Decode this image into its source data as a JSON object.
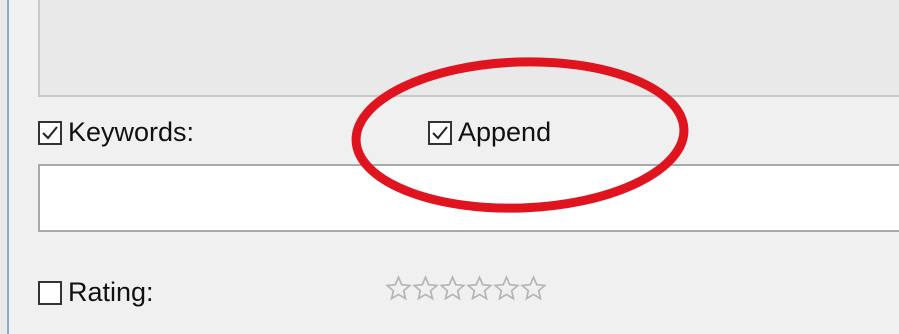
{
  "keywords": {
    "label": "Keywords:",
    "checked": true,
    "input_value": ""
  },
  "append": {
    "label": "Append",
    "checked": true
  },
  "rating": {
    "label": "Rating:",
    "checked": false,
    "value": 0,
    "max": 5
  },
  "colors": {
    "annotation": "#e0141f",
    "star_outline": "#b4b4b4"
  },
  "icons": {
    "check": "check-icon",
    "star": "star-outline-icon"
  }
}
